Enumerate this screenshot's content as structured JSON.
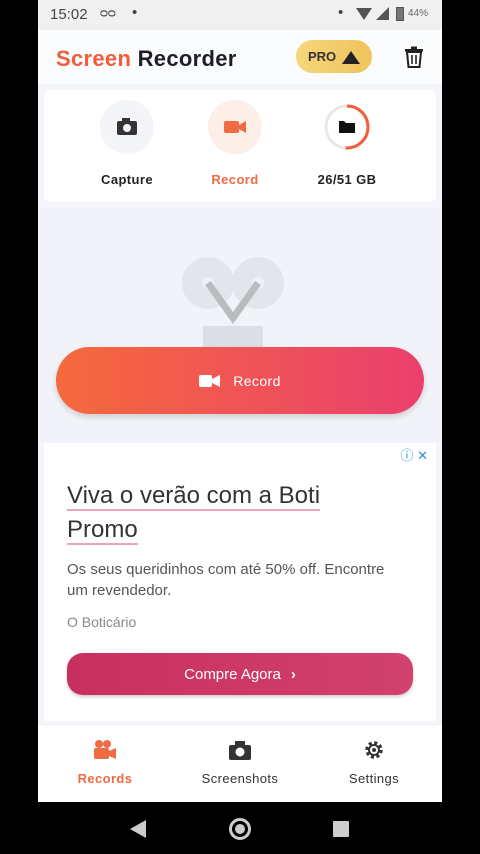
{
  "status_bar": {
    "time": "15:02",
    "voicemail_glyph": "ᴑᴑ",
    "dot": "•",
    "battery_percent": "44%"
  },
  "header": {
    "title_part1": "Screen",
    "title_part2": "Recorder",
    "pro_label": "PRO",
    "icons": [
      "crown-icon",
      "trash-icon"
    ]
  },
  "actions": [
    {
      "label": "Capture",
      "icon": "camera-icon"
    },
    {
      "label": "Record",
      "icon": "video-camera-icon"
    },
    {
      "label": "26/51 GB",
      "icon": "folder-icon",
      "storage_used_fraction": 0.51
    }
  ],
  "record_button": {
    "label": "Record",
    "icon": "video-camera-icon"
  },
  "ad": {
    "headline": "Viva o verão com a Boti Promo",
    "body": "Os seus queridinhos com até 50% off. Encontre um revendedor.",
    "advertiser": "O Boticário",
    "cta": "Compre Agora",
    "cta_chevron": "›",
    "choices_glyph": "ⓘ ✕"
  },
  "bottom_nav": [
    {
      "label": "Records",
      "icon": "video-camera-icon",
      "active": true
    },
    {
      "label": "Screenshots",
      "icon": "camera-icon",
      "active": false
    },
    {
      "label": "Settings",
      "icon": "gear-icon",
      "active": false
    }
  ],
  "colors": {
    "accent": "#f06a43",
    "record_gradient_start": "#f56a3c",
    "record_gradient_end": "#eb3f6e",
    "pro_badge": "#f2cb66",
    "ad_cta": "#c82f5e"
  }
}
